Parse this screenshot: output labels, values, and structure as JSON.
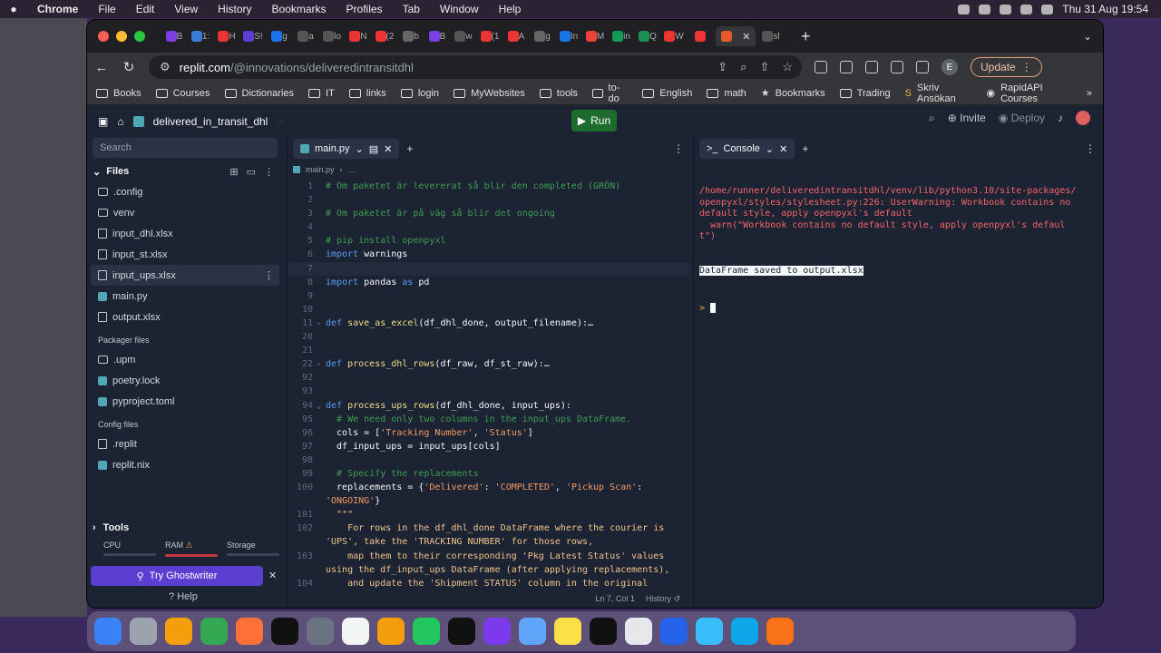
{
  "menubar": {
    "app": "Chrome",
    "items": [
      "File",
      "Edit",
      "View",
      "History",
      "Bookmarks",
      "Profiles",
      "Tab",
      "Window",
      "Help"
    ],
    "clock": "Thu 31 Aug  19:54"
  },
  "browser": {
    "tab_letters": [
      "B",
      "1:",
      "H",
      "S!",
      "g",
      "a",
      "lo",
      "N",
      "(2",
      "b",
      "B",
      "w",
      "(1",
      "A",
      "g",
      "In",
      "M",
      "in",
      "Q",
      "W",
      "",
      "Fi",
      "sl"
    ],
    "active_tab_close": "✕",
    "url_host": "replit.com",
    "url_path": "/@innovations/deliveredintransitdhl",
    "profile_initial": "E",
    "update_label": "Update",
    "bookmarks": [
      {
        "label": "Books",
        "icon": "folder"
      },
      {
        "label": "Courses",
        "icon": "folder"
      },
      {
        "label": "Dictionaries",
        "icon": "folder"
      },
      {
        "label": "IT",
        "icon": "folder"
      },
      {
        "label": "links",
        "icon": "folder"
      },
      {
        "label": "login",
        "icon": "folder"
      },
      {
        "label": "MyWebsites",
        "icon": "folder"
      },
      {
        "label": "tools",
        "icon": "folder"
      },
      {
        "label": "to-do",
        "icon": "folder"
      },
      {
        "label": "English",
        "icon": "folder"
      },
      {
        "label": "math",
        "icon": "folder"
      },
      {
        "label": "Bookmarks",
        "icon": "star"
      },
      {
        "label": "Trading",
        "icon": "folder"
      },
      {
        "label": "Skriv Ansökan",
        "icon": "S"
      },
      {
        "label": "RapidAPI Courses",
        "icon": "rapidapi"
      }
    ],
    "bookmarks_more": "»"
  },
  "replit": {
    "project": "delivered_in_transit_dhl",
    "run_label": "Run",
    "invite_label": "Invite",
    "deploy_label": "Deploy",
    "search_placeholder": "Search",
    "files_label": "Files",
    "files": [
      ".config",
      "venv",
      "input_dhl.xlsx",
      "input_st.xlsx",
      "input_ups.xlsx",
      "main.py",
      "output.xlsx"
    ],
    "packager_label": "Packager files",
    "packager_files": [
      ".upm",
      "poetry.lock",
      "pyproject.toml"
    ],
    "config_label": "Config files",
    "config_files": [
      ".replit",
      "replit.nix"
    ],
    "tools_label": "Tools",
    "cpu_label": "CPU",
    "ram_label": "RAM",
    "storage_label": "Storage",
    "ghostwriter_label": "Try Ghostwriter",
    "help_label": "Help",
    "editor_tab": "main.py",
    "breadcrumb": "main.py",
    "breadcrumb_more": "…",
    "status_pos": "Ln 7, Col 1",
    "status_history": "History",
    "console_tab": "Console",
    "console_lines": [
      "/home/runner/deliveredintransitdhl/venv/lib/python3.10/site-packages/openpyxl/styles/stylesheet.py:226: UserWarning: Workbook contains no default style, apply openpyxl's default",
      "  warn(\"Workbook contains no default style, apply openpyxl's default\")"
    ],
    "console_ok": "DataFrame saved to output.xlsx",
    "console_prompt": ">"
  },
  "code_lines": [
    {
      "n": "1",
      "html": "<span class='cm'># Om paketet är levererat så blir den completed (GRÖN)</span>"
    },
    {
      "n": "2",
      "html": ""
    },
    {
      "n": "3",
      "html": "<span class='cm'># Om paketet är på väg så blir det ongoing</span>"
    },
    {
      "n": "4",
      "html": ""
    },
    {
      "n": "5",
      "html": "<span class='cm'># pip install openpyxl</span>"
    },
    {
      "n": "6",
      "html": "<span class='kw'>import</span> warnings"
    },
    {
      "n": "7",
      "html": "",
      "cur": true
    },
    {
      "n": "8",
      "html": "<span class='kw'>import</span> pandas <span class='kw'>as</span> pd"
    },
    {
      "n": "9",
      "html": ""
    },
    {
      "n": "10",
      "html": ""
    },
    {
      "n": "11",
      "fold": "›",
      "html": "<span class='kw'>def</span> <span class='fn'>save_as_excel</span>(df_dhl_done, output_filename):…"
    },
    {
      "n": "20",
      "html": ""
    },
    {
      "n": "21",
      "html": ""
    },
    {
      "n": "22",
      "fold": "›",
      "html": "<span class='kw'>def</span> <span class='fn'>process_dhl_rows</span>(df_raw, df_st_raw):…"
    },
    {
      "n": "92",
      "html": ""
    },
    {
      "n": "93",
      "html": ""
    },
    {
      "n": "94",
      "fold": "⌄",
      "html": "<span class='kw'>def</span> <span class='fn'>process_ups_rows</span>(df_dhl_done, input_ups):"
    },
    {
      "n": "95",
      "html": "  <span class='cm'># We need only two columns in the input_ups DataFrame.</span>"
    },
    {
      "n": "96",
      "html": "  cols = [<span class='st'>'Tracking Number'</span>, <span class='st'>'Status'</span>]"
    },
    {
      "n": "97",
      "html": "  df_input_ups = input_ups[cols]"
    },
    {
      "n": "98",
      "html": ""
    },
    {
      "n": "99",
      "html": "  <span class='cm'># Specify the replacements</span>"
    },
    {
      "n": "100",
      "html": "  replacements = {<span class='st'>'Delivered'</span>: <span class='st'>'COMPLETED'</span>, <span class='st'>'Pickup Scan'</span>:"
    },
    {
      "n": "",
      "html": "<span class='st'>'ONGOING'</span>}"
    },
    {
      "n": "101",
      "html": "  <span class='dc'>\"\"\"</span>"
    },
    {
      "n": "102",
      "html": "<span class='dc'>    For rows in the df_dhl_done DataFrame where the courier is</span>"
    },
    {
      "n": "",
      "html": "<span class='dc'>'UPS', take the 'TRACKING NUMBER' for those rows,</span>"
    },
    {
      "n": "103",
      "html": "<span class='dc'>    map them to their corresponding 'Pkg Latest Status' values</span>"
    },
    {
      "n": "",
      "html": "<span class='dc'>using the df_input_ups DataFrame (after applying replacements),</span>"
    },
    {
      "n": "104",
      "html": "<span class='dc'>    and update the 'Shipment STATUS' column in the original</span>"
    }
  ],
  "colors": {
    "accent": "#1e6b2e",
    "ghostwriter": "#5b3fd1",
    "console_error": "#f4646b"
  }
}
